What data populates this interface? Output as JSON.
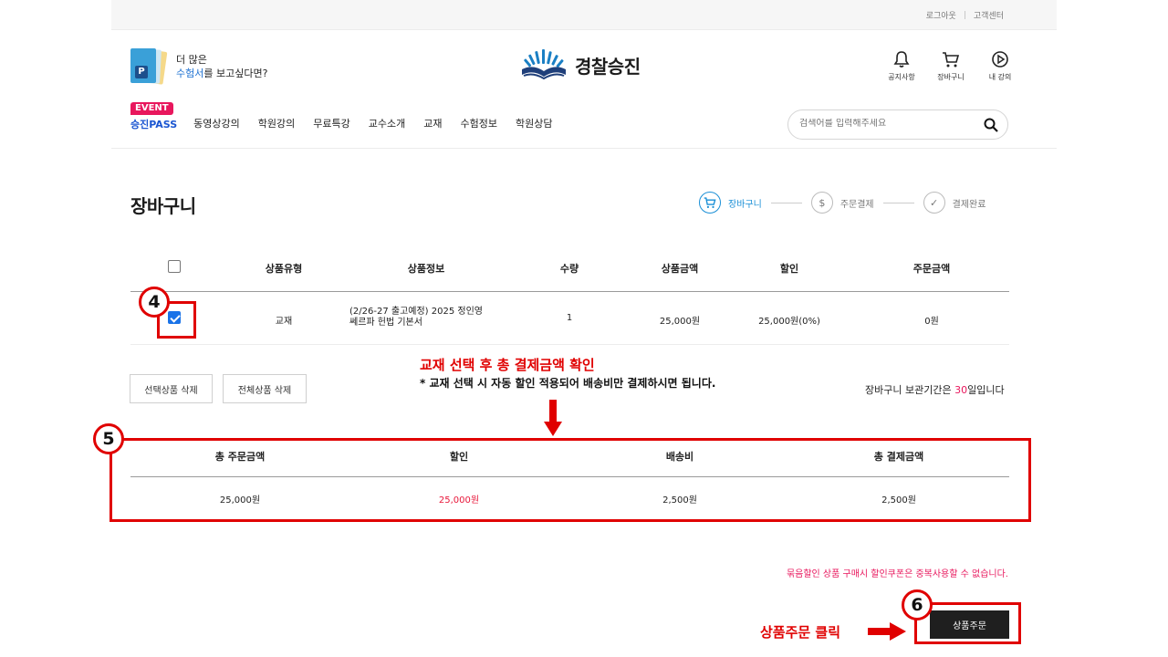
{
  "topbar": {
    "logout": "로그아웃",
    "separator": "|",
    "support": "고객센터"
  },
  "promo": {
    "line1": "더 많은",
    "highlight": "수험서",
    "line2_rest": "를 보고싶다면?"
  },
  "logo": {
    "text": "경찰승진"
  },
  "header_icons": [
    {
      "label": "공지사항",
      "icon": "bell-icon"
    },
    {
      "label": "장바구니",
      "icon": "cart-icon"
    },
    {
      "label": "내 강의",
      "icon": "play-icon"
    }
  ],
  "nav": {
    "event_badge": "EVENT",
    "event_label": "승진PASS",
    "items": [
      "동영상강의",
      "학원강의",
      "무료특강",
      "교수소개",
      "교재",
      "수험정보",
      "학원상담"
    ]
  },
  "search": {
    "placeholder": "검색어를 입력해주세요"
  },
  "page": {
    "title": "장바구니"
  },
  "steps": [
    {
      "label": "장바구니",
      "active": true,
      "symbol": "🛒"
    },
    {
      "label": "주문결제",
      "active": false,
      "symbol": "$"
    },
    {
      "label": "결제완료",
      "active": false,
      "symbol": "✓"
    }
  ],
  "cart": {
    "headers": [
      "상품유형",
      "상품정보",
      "수량",
      "상품금액",
      "할인",
      "주문금액"
    ],
    "rows": [
      {
        "type": "교재",
        "info_line1": "(2/26-27 출고예정) 2025 정인영",
        "info_line2": "쎄르파 헌법 기본서",
        "qty": "1",
        "price": "25,000원",
        "discount": "25,000원(0%)",
        "order_amount": "0원",
        "checked": true
      }
    ],
    "delete_selected": "선택상품 삭제",
    "delete_all": "전체상품 삭제",
    "retention_pre": "장바구니 보관기간은 ",
    "retention_days": "30",
    "retention_post": "일입니다"
  },
  "summary": {
    "headers": [
      "총 주문금액",
      "할인",
      "배송비",
      "총 결제금액"
    ],
    "values": [
      "25,000원",
      "25,000원",
      "2,500원",
      "2,500원"
    ]
  },
  "notice": {
    "duplicate": "묶음할인 상품 구매시 할인쿠폰은 중복사용할 수 없습니다."
  },
  "order_button": {
    "label": "상품주문"
  },
  "annotations": {
    "badge_4": "4",
    "badge_5": "5",
    "badge_6": "6",
    "title": "교재 선택 후 총 결제금액 확인",
    "note": "* 교재 선택 시 자동 할인 적용되어 배송비만 결제하시면 됩니다.",
    "order_click": "상품주문 클릭"
  },
  "colors": {
    "accent_red": "#e00000",
    "brand_pink": "#e8175d",
    "brand_blue": "#1a55d1",
    "step_active": "#1a8fd6"
  }
}
